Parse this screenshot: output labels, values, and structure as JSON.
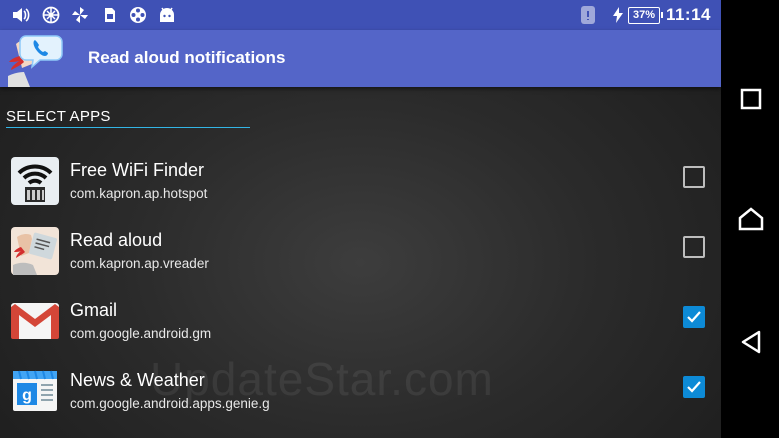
{
  "status_bar": {
    "time": "11:14",
    "battery": "37%",
    "left_icons": [
      "volume-icon",
      "no-network-icon",
      "fan-icon",
      "sim-icon",
      "film-reel-icon",
      "android-icon"
    ],
    "right_icons": [
      "phone-notification-icon",
      "charging-icon",
      "battery-icon"
    ]
  },
  "app_bar": {
    "title": "Read aloud notifications",
    "logo": "read-aloud-logo"
  },
  "section": {
    "title": "SELECT APPS"
  },
  "apps": [
    {
      "name": "Free WiFi Finder",
      "package": "com.kapron.ap.hotspot",
      "icon": "wifi-finder-icon",
      "checked": false
    },
    {
      "name": "Read aloud",
      "package": "com.kapron.ap.vreader",
      "icon": "read-aloud-icon",
      "checked": false
    },
    {
      "name": "Gmail",
      "package": "com.google.android.gm",
      "icon": "gmail-icon",
      "checked": true
    },
    {
      "name": "News & Weather",
      "package": "com.google.android.apps.genie.g",
      "icon": "news-weather-icon",
      "checked": true
    }
  ],
  "watermark": "UpdateStar.com",
  "nav_bar": {
    "buttons": [
      "recents-button",
      "home-button",
      "back-button"
    ]
  },
  "colors": {
    "status_bar": "#3f51b5",
    "app_bar": "#5465c8",
    "accent": "#33b5e5",
    "checkbox_checked": "#0d8ad6"
  }
}
